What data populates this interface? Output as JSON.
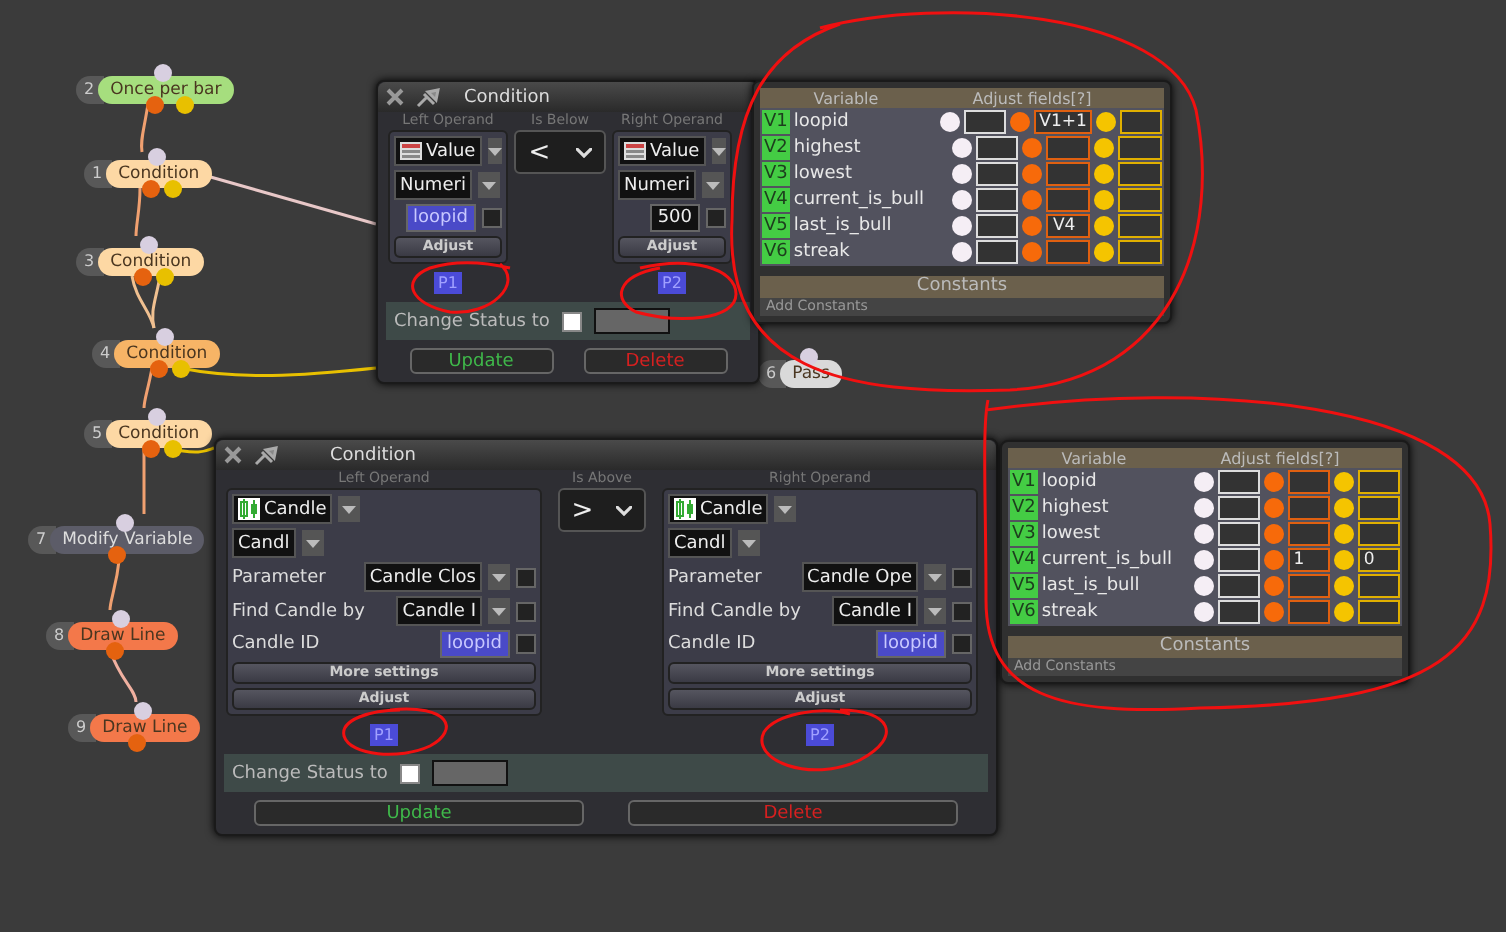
{
  "nodes": [
    {
      "number": "2",
      "label": "Once per bar",
      "color": "#a6de7e",
      "kind": "branch"
    },
    {
      "number": "1",
      "label": "Condition",
      "color": "#fdd8a4",
      "kind": "branch"
    },
    {
      "number": "3",
      "label": "Condition",
      "color": "#fdd8a4",
      "kind": "branch"
    },
    {
      "number": "4",
      "label": "Condition",
      "color": "#f7b466",
      "kind": "branch"
    },
    {
      "number": "5",
      "label": "Condition",
      "color": "#fdd8a4",
      "kind": "branch"
    },
    {
      "number": "7",
      "label": "Modify Variable",
      "color": "#5c5c68",
      "kind": "action"
    },
    {
      "number": "8",
      "label": "Draw Line",
      "color": "#f3784a",
      "kind": "action"
    },
    {
      "number": "9",
      "label": "Draw Line",
      "color": "#f3784a",
      "kind": "action"
    },
    {
      "number": "6",
      "label": "Pass",
      "color": "#d9d9d9",
      "kind": "end"
    }
  ],
  "condition_panels": [
    {
      "title": "Condition",
      "left_label": "Left Operand",
      "operator_label": "Is Below",
      "operator": "<",
      "right_label": "Right Operand",
      "left": {
        "source": {
          "kind": "value",
          "label": "Value"
        },
        "rows": [
          {
            "kind": "dropdown",
            "value": "Numeri"
          },
          {
            "kind": "chip",
            "value": "loopid",
            "variable": true,
            "checked": false
          }
        ],
        "buttons": [
          "Adjust"
        ],
        "tag": "P1"
      },
      "right": {
        "source": {
          "kind": "value",
          "label": "Value"
        },
        "rows": [
          {
            "kind": "dropdown",
            "value": "Numeri"
          },
          {
            "kind": "chip",
            "value": "500",
            "variable": false,
            "checked": false
          }
        ],
        "buttons": [
          "Adjust"
        ],
        "tag": "P2"
      },
      "status_label": "Change Status to",
      "status_checked": false,
      "buttons": [
        "Update",
        "Delete"
      ]
    },
    {
      "title": "Condition",
      "left_label": "Left Operand",
      "operator_label": "Is Above",
      "operator": ">",
      "right_label": "Right Operand",
      "left": {
        "source": {
          "kind": "candle",
          "label": "Candle"
        },
        "rows": [
          {
            "kind": "dropdown",
            "value": "Candl"
          },
          {
            "kind": "param",
            "label": "Parameter",
            "value": "Candle Clos",
            "checked": false
          },
          {
            "kind": "param",
            "label": "Find Candle by",
            "value": "Candle I",
            "checked": false
          },
          {
            "kind": "chip",
            "label": "Candle ID",
            "value": "loopid",
            "variable": true,
            "checked": false
          }
        ],
        "buttons": [
          "More settings",
          "Adjust"
        ],
        "tag": "P1"
      },
      "right": {
        "source": {
          "kind": "candle",
          "label": "Candle"
        },
        "rows": [
          {
            "kind": "dropdown",
            "value": "Candl"
          },
          {
            "kind": "param",
            "label": "Parameter",
            "value": "Candle Ope",
            "checked": false
          },
          {
            "kind": "param",
            "label": "Find Candle by",
            "value": "Candle I",
            "checked": false
          },
          {
            "kind": "chip",
            "label": "Candle ID",
            "value": "loopid",
            "variable": true,
            "checked": false
          }
        ],
        "buttons": [
          "More settings",
          "Adjust"
        ],
        "tag": "P2"
      },
      "status_label": "Change Status to",
      "status_checked": false,
      "buttons": [
        "Update",
        "Delete"
      ]
    }
  ],
  "variable_panels": [
    {
      "headers": [
        "Variable",
        "Adjust fields[?]"
      ],
      "rows": [
        {
          "id": "V1",
          "name": "loopid",
          "orange": "V1+1"
        },
        {
          "id": "V2",
          "name": "highest"
        },
        {
          "id": "V3",
          "name": "lowest"
        },
        {
          "id": "V4",
          "name": "current_is_bull"
        },
        {
          "id": "V5",
          "name": "last_is_bull",
          "orange": "V4"
        },
        {
          "id": "V6",
          "name": "streak"
        }
      ],
      "constants": "Constants",
      "add_constants": "Add Constants"
    },
    {
      "headers": [
        "Variable",
        "Adjust fields[?]"
      ],
      "rows": [
        {
          "id": "V1",
          "name": "loopid"
        },
        {
          "id": "V2",
          "name": "highest"
        },
        {
          "id": "V3",
          "name": "lowest"
        },
        {
          "id": "V4",
          "name": "current_is_bull",
          "orange": "1",
          "yellow": "0"
        },
        {
          "id": "V5",
          "name": "last_is_bull"
        },
        {
          "id": "V6",
          "name": "streak"
        }
      ],
      "constants": "Constants",
      "add_constants": "Add Constants"
    }
  ]
}
